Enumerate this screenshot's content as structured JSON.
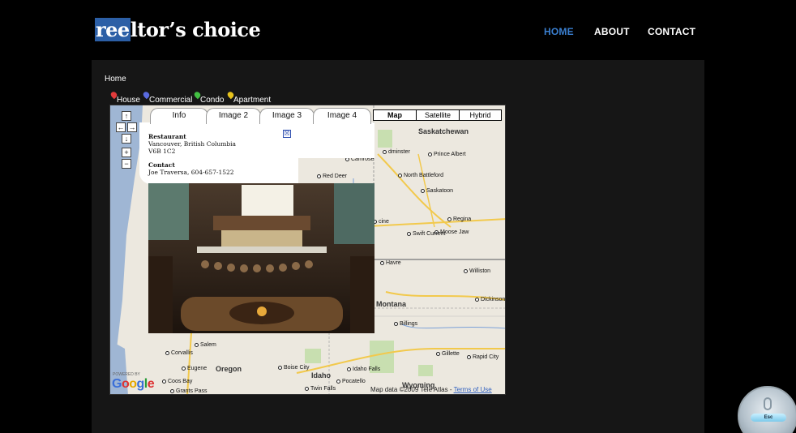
{
  "header": {
    "logo_highlight": "ree",
    "logo_rest": "ltor’s choice",
    "nav": [
      "HOME",
      "ABOUT",
      "CONTACT"
    ],
    "active_nav": "HOME"
  },
  "breadcrumb": "Home",
  "legend": [
    {
      "label": "House",
      "color": "#e33b3b"
    },
    {
      "label": "Commercial",
      "color": "#5a6be0"
    },
    {
      "label": "Condo",
      "color": "#43c043"
    },
    {
      "label": "Apartment",
      "color": "#e6c21c"
    }
  ],
  "map": {
    "map_types": [
      "Map",
      "Satellite",
      "Hybrid"
    ],
    "active_map_type": "Map",
    "nav_controls": [
      "↑",
      "←",
      "→",
      "↓",
      "+",
      "−"
    ],
    "cities": [
      "Saskatchewan",
      "Prince Albert",
      "Camrose",
      "dminster",
      "Red Deer",
      "North Battleford",
      "Saskatoon",
      "cine",
      "Regina",
      "Moose Jaw",
      "Swift Current",
      "Havre",
      "Williston",
      "Dickinson",
      "Billings",
      "Gillette",
      "Rapid City",
      "Salem",
      "Corvallis",
      "Eugene",
      "Coos Bay",
      "Grants Pass",
      "Boise City",
      "Idaho Falls",
      "Pocatello",
      "Twin Falls"
    ],
    "regions": [
      "Montana",
      "Oregon",
      "Idaho",
      "Wyoming"
    ],
    "attribution": "Map data ©2009 Tele Atlas - ",
    "terms_link": "Terms of Use",
    "powered_by": "POWERED BY",
    "google": "Google"
  },
  "info_window": {
    "tabs": [
      "Info",
      "Image 2",
      "Image 3",
      "Image 4"
    ],
    "active_tab": "Info",
    "close_symbol": "☒",
    "title": "Restaurant",
    "address_line1": "Vancouver, British Columbia",
    "address_line2": "V6B 1C2",
    "contact_label": "Contact",
    "contact_value": "Joe Traversa, 604-657-1522"
  },
  "esc_widget": {
    "label": "Esc"
  }
}
